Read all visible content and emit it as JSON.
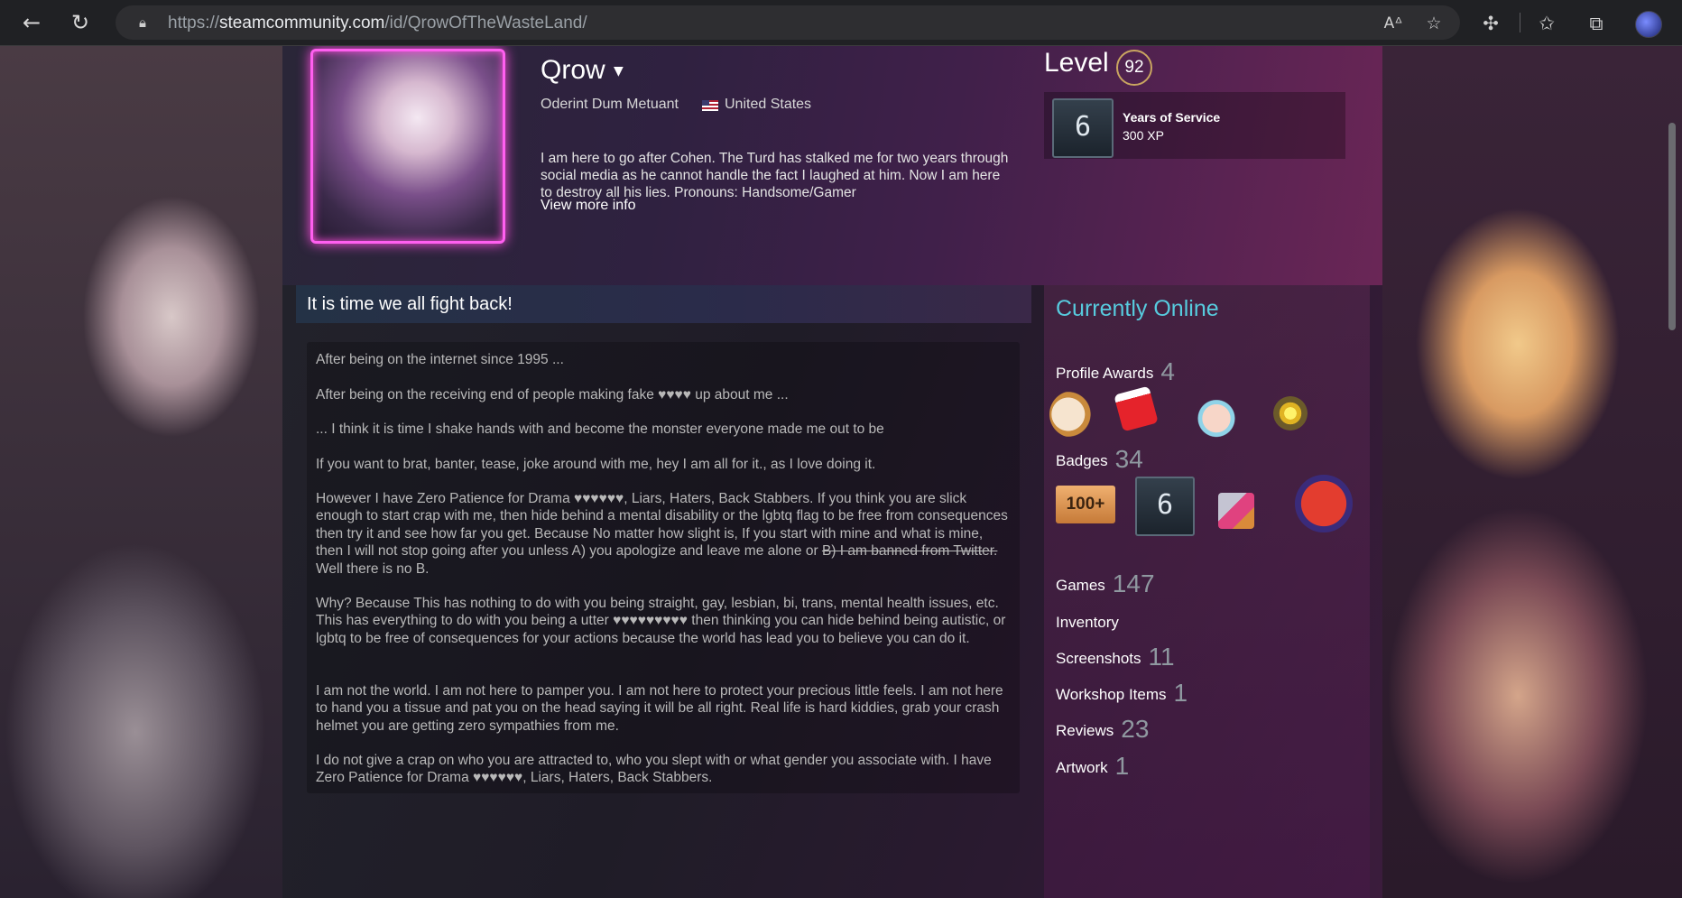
{
  "browser": {
    "url_prefix": "https://",
    "url_host": "steamcommunity.com",
    "url_path": "/id/QrowOfTheWasteLand/",
    "icons": [
      "back-icon",
      "refresh-icon",
      "lock-icon",
      "read-aloud-icon",
      "add-favorite-icon",
      "extensions-icon",
      "favorites-icon",
      "collections-icon",
      "profile-icon"
    ]
  },
  "profile": {
    "persona_name": "Qrow",
    "real_name": "Oderint Dum Metuant",
    "country": "United States",
    "summary": "I am here to go after Cohen. The Turd has stalked me for two years through social media as he cannot handle the fact I laughed at him. Now I am here to destroy all his lies. Pronouns: Handsome/Gamer",
    "view_more": "View more info"
  },
  "level": {
    "label": "Level",
    "value": "92",
    "badge_number": "6",
    "badge_name": "Years of Service",
    "badge_xp": "300 XP"
  },
  "showcase": {
    "title": "It is time we all fight back!",
    "paragraphs": [
      "After being on the internet since 1995 ...",
      "After being on the receiving end of people making fake ♥♥♥♥ up about me ...",
      "... I think it is time I shake hands with and become the monster everyone made me out to be",
      "If you want to brat, banter, tease, joke around with me, hey I am all for it., as I love doing it.",
      "However I have Zero Patience for Drama ♥♥♥♥♥♥, Liars, Haters, Back Stabbers. If you think you are slick enough to start crap with me, then hide behind a mental disability or the lgbtq flag to be free from consequences then try it and see how far you get. Because No matter how slight is, If you start with mine and what is mine, then I will not stop going after you unless A) you apologize and leave me alone or",
      "B) I am banned from Twitter.",
      " Well there is no B.",
      "Why? Because This has nothing to do with you being straight, gay, lesbian, bi, trans, mental health issues, etc. This has everything to do with you being a utter ♥♥♥♥♥♥♥♥♥ then thinking you can hide behind being autistic, or lgbtq to be free of consequences for your actions because the world has lead you to believe you can do it.",
      "I am not the world. I am not here to pamper you. I am not here to protect your precious little feels. I am not here to hand you a tissue and pat you on the head saying it will be all right. Real life is hard kiddies, grab your crash helmet you are getting zero sympathies from me.",
      "I do not give a crap on who you are attracted to, who you slept with or what gender you associate with. I have Zero Patience for Drama ♥♥♥♥♥♥, Liars, Haters, Back Stabbers."
    ]
  },
  "sidebar": {
    "status": "Currently Online",
    "profile_awards_label": "Profile Awards",
    "profile_awards_count": "4",
    "badges_label": "Badges",
    "badges_count": "34",
    "badge_icon_number": "6",
    "badge_100_text": "100+",
    "games_label": "Games",
    "games_count": "147",
    "inventory_label": "Inventory",
    "screenshots_label": "Screenshots",
    "screenshots_count": "11",
    "workshop_label": "Workshop Items",
    "workshop_count": "1",
    "reviews_label": "Reviews",
    "reviews_count": "23",
    "artwork_label": "Artwork",
    "artwork_count": "1"
  },
  "colors": {
    "online_title": "#57cbde",
    "avatar_frame": "#ff5ff0",
    "level_ring": "#c9a560"
  }
}
